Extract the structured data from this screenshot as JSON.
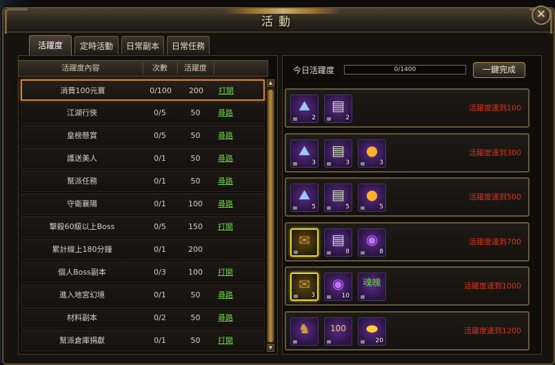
{
  "window": {
    "title": "活動",
    "close_label": "✕"
  },
  "tabs": [
    {
      "label": "活躍度",
      "active": true
    },
    {
      "label": "定時活動",
      "active": false
    },
    {
      "label": "日常副本",
      "active": false
    },
    {
      "label": "日常任務",
      "active": false
    }
  ],
  "table": {
    "headers": {
      "content": "活躍度內容",
      "count": "次數",
      "points": "活躍度"
    },
    "rows": [
      {
        "name": "消費100元寶",
        "count": "0/100",
        "points": "200",
        "action": "打開",
        "selected": true
      },
      {
        "name": "江湖行俠",
        "count": "0/5",
        "points": "50",
        "action": "尋路"
      },
      {
        "name": "皇榜懸賞",
        "count": "0/5",
        "points": "50",
        "action": "尋路"
      },
      {
        "name": "護送美人",
        "count": "0/1",
        "points": "50",
        "action": "尋路"
      },
      {
        "name": "幫派任務",
        "count": "0/1",
        "points": "50",
        "action": "尋路"
      },
      {
        "name": "守衛襄陽",
        "count": "0/1",
        "points": "100",
        "action": "尋路"
      },
      {
        "name": "擊殺60級以上Boss",
        "count": "0/5",
        "points": "150",
        "action": "打開"
      },
      {
        "name": "累計線上180分鐘",
        "count": "0/1",
        "points": "200",
        "action": ""
      },
      {
        "name": "個人Boss副本",
        "count": "0/3",
        "points": "100",
        "action": "打開"
      },
      {
        "name": "進入地宮幻境",
        "count": "0/1",
        "points": "50",
        "action": "尋路"
      },
      {
        "name": "材料副本",
        "count": "0/2",
        "points": "50",
        "action": "尋路"
      },
      {
        "name": "幫派倉庫捐獻",
        "count": "0/1",
        "points": "50",
        "action": "打開"
      }
    ]
  },
  "today": {
    "label": "今日活躍度",
    "progress_text": "0/1400",
    "progress_fraction": 0,
    "claim_all_label": "一鍵完成"
  },
  "rewards": [
    {
      "requirement": "活躍度達到100",
      "items": [
        {
          "icon": "map-icon",
          "glyph": "⛰",
          "count": "2",
          "gold": false
        },
        {
          "icon": "book-icon",
          "glyph": "▤",
          "count": "2",
          "gold": false
        }
      ]
    },
    {
      "requirement": "活躍度達到300",
      "items": [
        {
          "icon": "map-icon",
          "glyph": "⛰",
          "count": "3",
          "gold": false
        },
        {
          "icon": "book-icon",
          "glyph": "▤",
          "count": "3",
          "gold": false
        },
        {
          "icon": "orb-icon",
          "glyph": "●",
          "count": "3",
          "gold": false
        }
      ]
    },
    {
      "requirement": "活躍度達到500",
      "items": [
        {
          "icon": "map-icon",
          "glyph": "⛰",
          "count": "5",
          "gold": false
        },
        {
          "icon": "book-icon",
          "glyph": "▤",
          "count": "5",
          "gold": false
        },
        {
          "icon": "orb-icon",
          "glyph": "●",
          "count": "5",
          "gold": false
        }
      ]
    },
    {
      "requirement": "活躍度達到700",
      "items": [
        {
          "icon": "scroll-icon",
          "glyph": "✉",
          "count": "",
          "gold": true
        },
        {
          "icon": "book-icon",
          "glyph": "▤",
          "count": "8",
          "gold": false
        },
        {
          "icon": "purple-orb-icon",
          "glyph": "◉",
          "count": "8",
          "gold": false
        }
      ]
    },
    {
      "requirement": "活躍度達到1000",
      "items": [
        {
          "icon": "scroll-icon",
          "glyph": "✉",
          "count": "3",
          "gold": true
        },
        {
          "icon": "purple-orb-icon",
          "glyph": "◉",
          "count": "10",
          "gold": false
        },
        {
          "icon": "soul-icon",
          "glyph": "魂魄",
          "count": "",
          "gold": false
        }
      ]
    },
    {
      "requirement": "活躍度達到1200",
      "items": [
        {
          "icon": "beast-icon",
          "glyph": "♞",
          "count": "",
          "gold": false
        },
        {
          "icon": "gold-ingot-icon",
          "glyph": "100",
          "count": "",
          "gold": false
        },
        {
          "icon": "gold-bar-icon",
          "glyph": "⬬",
          "count": "20",
          "gold": false
        }
      ]
    }
  ]
}
